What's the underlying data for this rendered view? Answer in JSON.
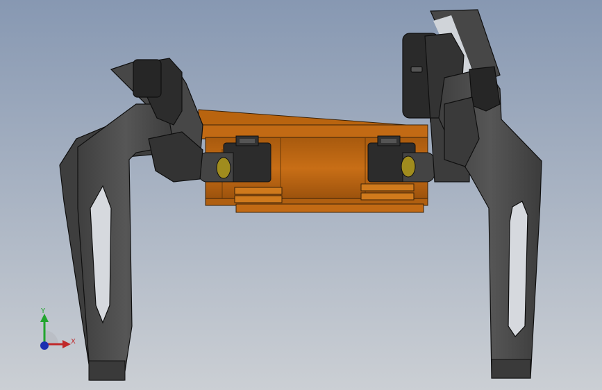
{
  "viewport": {
    "background_top": "#8a9bb3",
    "background_bottom": "#c9cdd3"
  },
  "model": {
    "body_color": "#c26a14",
    "body_edge_color": "#3a2208",
    "leg_color": "#4b4b4b",
    "leg_edge_color": "#0f0f0f",
    "joint_color": "#2a2a2a",
    "pin_color": "#a08c1e"
  },
  "triad": {
    "x_label": "X",
    "y_label": "Y",
    "x_color": "#c0282a",
    "y_color": "#22a52e",
    "z_color": "#1c2fb0"
  }
}
